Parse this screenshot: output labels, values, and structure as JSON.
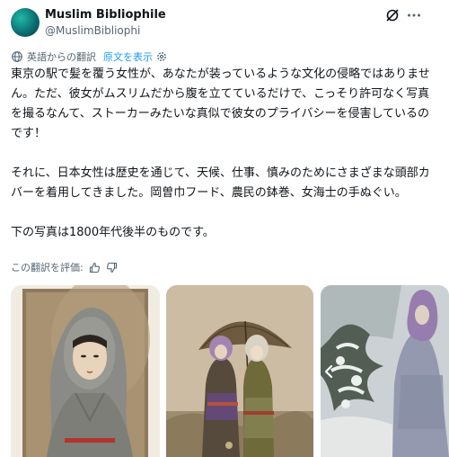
{
  "author": {
    "name": "Muslim Bibliophile",
    "handle": "@MuslimBibliophi"
  },
  "header_icons": [
    "grok-icon",
    "more-icon"
  ],
  "translation": {
    "label": "英語からの翻訳",
    "show_original": "原文を表示"
  },
  "body": {
    "paragraph1": "東京の駅で髪を覆う女性が、あなたが装っているような文化の侵略ではありません。ただ、彼女がムスリムだから腹を立てているだけで、こっそり許可なく写真を撮るなんて、ストーカーみたいな真似で彼女のプライバシーを侵害しているのです！",
    "paragraph2": "それに、日本女性は歴史を通じて、天候、仕事、慎みのためにさまざまな頭部カバーを着用してきました。岡曽巾フード、農民の鉢巻、女海士の手ぬぐい。",
    "paragraph3": "下の写真は1800年代後半のものです。"
  },
  "rate": {
    "label": "この翻訳を評価:"
  },
  "colors": {
    "link": "#1d9bf0",
    "secondary_text": "#536471",
    "primary_text": "#0f1419"
  }
}
